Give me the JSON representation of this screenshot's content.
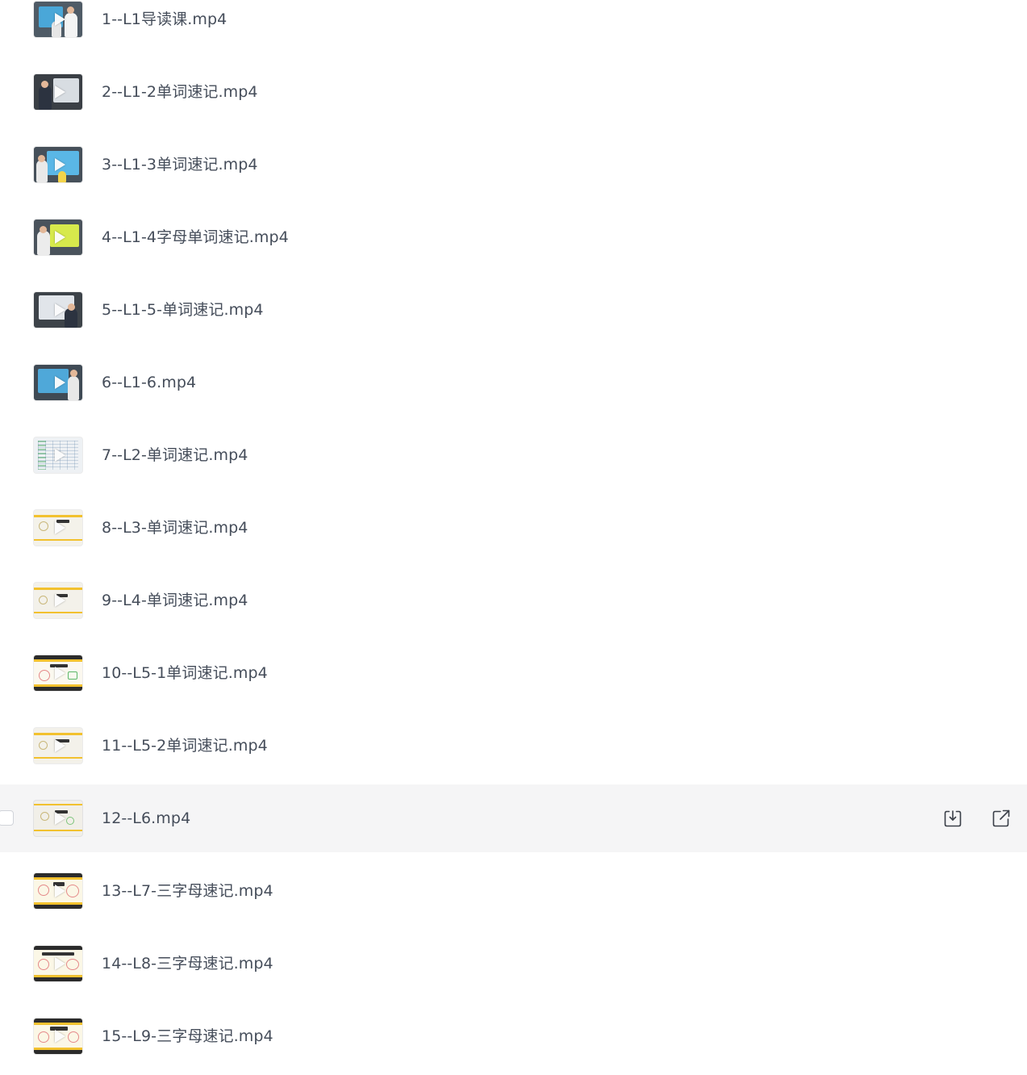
{
  "files": [
    {
      "name": "1--L1导读课.mp4",
      "thumb": "video-thumbnail-icon"
    },
    {
      "name": "2--L1-2单词速记.mp4",
      "thumb": "video-thumbnail-icon"
    },
    {
      "name": "3--L1-3单词速记.mp4",
      "thumb": "video-thumbnail-icon"
    },
    {
      "name": "4--L1-4字母单词速记.mp4",
      "thumb": "video-thumbnail-icon"
    },
    {
      "name": "5--L1-5-单词速记.mp4",
      "thumb": "video-thumbnail-icon"
    },
    {
      "name": "6--L1-6.mp4",
      "thumb": "video-thumbnail-icon"
    },
    {
      "name": "7--L2-单词速记.mp4",
      "thumb": "video-thumbnail-icon"
    },
    {
      "name": "8--L3-单词速记.mp4",
      "thumb": "video-thumbnail-icon"
    },
    {
      "name": "9--L4-单词速记.mp4",
      "thumb": "video-thumbnail-icon"
    },
    {
      "name": "10--L5-1单词速记.mp4",
      "thumb": "video-thumbnail-icon"
    },
    {
      "name": "11--L5-2单词速记.mp4",
      "thumb": "video-thumbnail-icon"
    },
    {
      "name": "12--L6.mp4",
      "thumb": "video-thumbnail-icon",
      "hovered": true,
      "actions": [
        "download-icon",
        "share-icon"
      ]
    },
    {
      "name": "13--L7-三字母速记.mp4",
      "thumb": "video-thumbnail-icon"
    },
    {
      "name": "14--L8-三字母速记.mp4",
      "thumb": "video-thumbnail-icon"
    },
    {
      "name": "15--L9-三字母速记.mp4",
      "thumb": "video-thumbnail-icon"
    }
  ],
  "colors": {
    "text": "#454d5a",
    "hover_row": "#f5f5f6",
    "icon": "#3a3f48"
  }
}
